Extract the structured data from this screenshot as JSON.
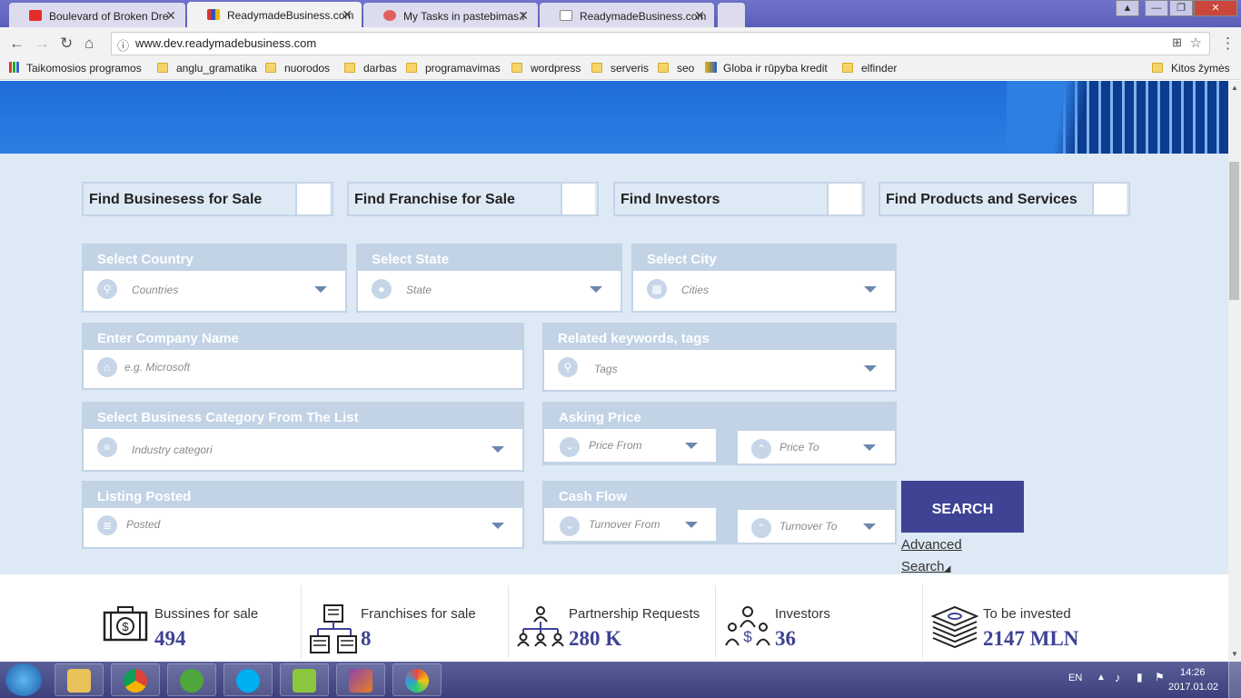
{
  "browser": {
    "tabs": [
      {
        "title": "Boulevard of Broken Dre",
        "color": "#e52d27"
      },
      {
        "title": "ReadymadeBusiness.com",
        "color": "#3050c0"
      },
      {
        "title": "My Tasks in pastebimas.l",
        "color": "#e06060"
      },
      {
        "title": "ReadymadeBusiness.com",
        "color": "#999999"
      }
    ],
    "url": "www.dev.readymadebusiness.com",
    "bookmarks": [
      "Taikomosios programos",
      "anglu_gramatika",
      "nuorodos",
      "darbas",
      "programavimas",
      "wordpress",
      "serveris",
      "seo",
      "Globa ir rūpyba kredit",
      "elfinder",
      "Kitos žymės"
    ]
  },
  "finders": [
    "Find Businesess for Sale",
    "Find Franchise for Sale",
    "Find Investors",
    "Find Products and Services"
  ],
  "fields": {
    "country": {
      "label": "Select Country",
      "placeholder": "Countries",
      "icon": "search-icon"
    },
    "state": {
      "label": "Select State",
      "placeholder": "State",
      "icon": "map-pin-icon"
    },
    "city": {
      "label": "Select City",
      "placeholder": "Cities",
      "icon": "city-icon"
    },
    "company": {
      "label": "Enter Company Name",
      "placeholder": "e.g. Microsoft",
      "icon": "home-icon"
    },
    "keywords": {
      "label": "Related keywords, tags",
      "placeholder": "Tags",
      "icon": "search-icon"
    },
    "category": {
      "label": "Select Business Category From The List",
      "placeholder": "Industry categori",
      "icon": "list-icon"
    },
    "price": {
      "label": "Asking Price",
      "from": "Price From",
      "to": "Price To"
    },
    "posted": {
      "label": "Listing Posted",
      "placeholder": "Posted",
      "icon": "list-icon"
    },
    "cashflow": {
      "label": "Cash Flow",
      "from": "Turnover From",
      "to": "Turnover To"
    }
  },
  "search_label": "SEARCH",
  "advanced_1": "Advanced",
  "advanced_2": "Search",
  "stats": [
    {
      "title": "Bussines for sale",
      "value": "494",
      "icon": "briefcase-dollar-icon"
    },
    {
      "title": "Franchises for sale",
      "value": "8",
      "icon": "franchise-network-icon"
    },
    {
      "title": "Partnership Requests",
      "value": "280 K",
      "icon": "partnership-icon"
    },
    {
      "title": "Investors",
      "value": "36",
      "icon": "investors-icon"
    },
    {
      "title": "To be invested",
      "value": "2147 MLN",
      "icon": "money-stack-icon"
    }
  ],
  "taskbar": {
    "lang": "EN",
    "time": "14:26",
    "date": "2017.01.02"
  },
  "colors": {
    "accent": "#3e4394",
    "field_header": "#c2d3e6",
    "form_bg": "#dde9f4",
    "hero": "#1f6cd8"
  }
}
